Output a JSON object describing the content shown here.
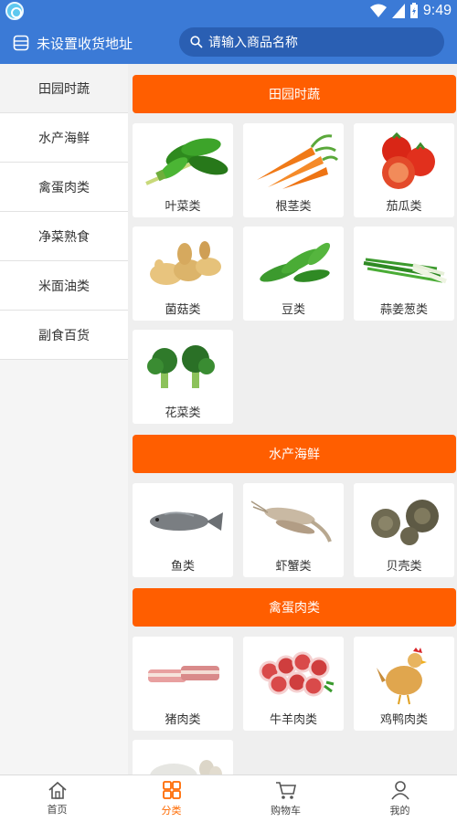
{
  "status_bar": {
    "time": "9:49",
    "icons": [
      "wifi-icon",
      "signal-icon",
      "battery-icon"
    ]
  },
  "header": {
    "address_label": "未设置收货地址",
    "search_placeholder": "请输入商品名称"
  },
  "sidebar": {
    "items": [
      {
        "label": "田园时蔬",
        "active": true
      },
      {
        "label": "水产海鲜",
        "active": false
      },
      {
        "label": "禽蛋肉类",
        "active": false
      },
      {
        "label": "净菜熟食",
        "active": false
      },
      {
        "label": "米面油类",
        "active": false
      },
      {
        "label": "副食百货",
        "active": false
      }
    ]
  },
  "sections": [
    {
      "title": "田园时蔬",
      "items": [
        {
          "label": "叶菜类",
          "icon": "leafy-greens-image"
        },
        {
          "label": "根茎类",
          "icon": "carrot-image"
        },
        {
          "label": "茄瓜类",
          "icon": "tomato-image"
        },
        {
          "label": "菌菇类",
          "icon": "ginger-image"
        },
        {
          "label": "豆类",
          "icon": "pea-pods-image"
        },
        {
          "label": "蒜姜葱类",
          "icon": "scallion-image"
        },
        {
          "label": "花菜类",
          "icon": "broccoli-image"
        }
      ]
    },
    {
      "title": "水产海鲜",
      "items": [
        {
          "label": "鱼类",
          "icon": "fish-image"
        },
        {
          "label": "虾蟹类",
          "icon": "shrimp-image"
        },
        {
          "label": "贝壳类",
          "icon": "snail-shell-image"
        }
      ]
    },
    {
      "title": "禽蛋肉类",
      "items": [
        {
          "label": "猪肉类",
          "icon": "pork-belly-image"
        },
        {
          "label": "牛羊肉类",
          "icon": "beef-roll-image"
        },
        {
          "label": "鸡鸭肉类",
          "icon": "chicken-image"
        }
      ]
    }
  ],
  "tabbar": {
    "tabs": [
      {
        "label": "首页",
        "icon": "home-icon",
        "active": false
      },
      {
        "label": "分类",
        "icon": "category-grid-icon",
        "active": true
      },
      {
        "label": "购物车",
        "icon": "cart-icon",
        "active": false
      },
      {
        "label": "我的",
        "icon": "user-icon",
        "active": false
      }
    ]
  },
  "colors": {
    "primary": "#3b7ad6",
    "accent": "#ff5e00",
    "tab_active": "#ff6a00"
  }
}
